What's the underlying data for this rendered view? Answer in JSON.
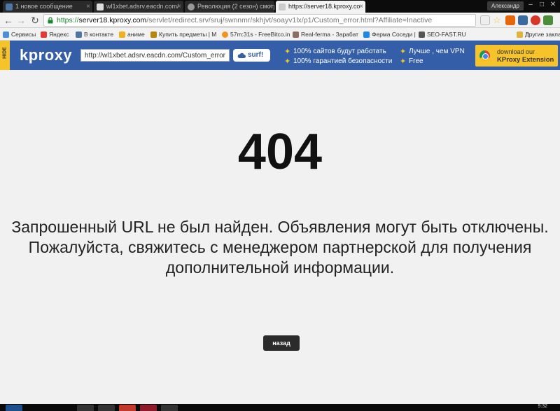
{
  "browser": {
    "tabs": [
      {
        "title": "1 новое сообщение",
        "active": false,
        "icon": "message-icon",
        "color": "#4a76a8"
      },
      {
        "title": "wl1xbet.adsrv.eacdn.com/",
        "active": false,
        "icon": "page-icon",
        "color": "#dddddd"
      },
      {
        "title": "Революция (2 сезон) смотр",
        "active": false,
        "icon": "mask-icon",
        "color": "#999999"
      },
      {
        "title": "https://server18.kproxy.co",
        "active": true,
        "icon": "page-icon",
        "color": "#cccccc"
      }
    ],
    "profile": "Александр",
    "window_controls": {
      "minimize": "–",
      "maximize": "□",
      "close": "✕"
    }
  },
  "toolbar": {
    "back": "←",
    "forward": "→",
    "reload": "↻",
    "url_scheme": "https://",
    "url_host": "server18.kproxy.com",
    "url_path": "/servlet/redirect.srv/sruj/swnnmr/skhjvt/soayv1lx/p1/Custom_error.html?Affiliate=Inactive"
  },
  "bookmarks": {
    "items": [
      {
        "label": "Сервисы",
        "color": "#4a90d9"
      },
      {
        "label": "Яндекс",
        "color": "#e53935"
      },
      {
        "label": "В контакте",
        "color": "#4a76a8"
      },
      {
        "label": "аниме",
        "color": "#f2b01e"
      },
      {
        "label": "Купить предметы | M",
        "color": "#b8860b"
      },
      {
        "label": "57m:31s - FreeBitco.in",
        "color": "#f7931a"
      },
      {
        "label": "Real-ferma - Зарабат",
        "color": "#8d6e63"
      },
      {
        "label": "Ферма Соседи |",
        "color": "#1e88e5"
      },
      {
        "label": "SEO-FAST.RU",
        "color": "#555555"
      }
    ],
    "more": "»",
    "other": "Другие закладки"
  },
  "kproxy": {
    "hide_label": "HIDE",
    "logo": "kproxy",
    "url_value": "http://wl1xbet.adsrv.eacdn.com/Custom_error",
    "surf_label": "surf!",
    "features": [
      "100% сайтов будут работать",
      "100% гарантией безопасности",
      "Лучше , чем VPN",
      "Free"
    ],
    "download_line1": "download our",
    "download_line2": "KProxy Extension",
    "accent": "#345ea8",
    "yellow": "#f6c32a"
  },
  "page": {
    "code": "404",
    "message": "Запрошенный URL не был найден. Объявления могут быть отключены. Пожалуйста, свяжитесь с менеджером партнерской для получения дополнительной информации.",
    "back_label": "назад"
  },
  "taskbar": {
    "clock": "9:32"
  }
}
